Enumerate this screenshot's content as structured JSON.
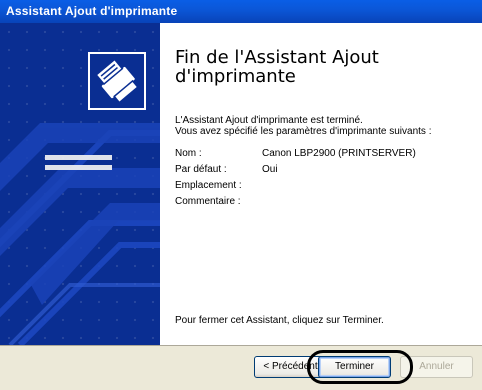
{
  "window": {
    "title": "Assistant Ajout d'imprimante"
  },
  "page": {
    "heading": "Fin de l'Assistant Ajout d'imprimante",
    "intro_line1": "L'Assistant Ajout d'imprimante est terminé.",
    "intro_line2": "Vous avez spécifié les paramètres d'imprimante suivants :",
    "fields": [
      {
        "label": "Nom :",
        "value": "Canon LBP2900 (PRINTSERVER)"
      },
      {
        "label": "Par défaut :",
        "value": "Oui"
      },
      {
        "label": "Emplacement :",
        "value": ""
      },
      {
        "label": "Commentaire :",
        "value": ""
      }
    ],
    "closing": "Pour fermer cet Assistant, cliquez sur Terminer."
  },
  "buttons": {
    "back_label": "< Précédent",
    "finish_label": "Terminer",
    "cancel_label": "Annuler"
  },
  "colors": {
    "title_bar": "#0b57d8",
    "side_panel": "#0a2e92",
    "dialog_background": "#ece9d8"
  },
  "icons": {
    "wizard_logo": "printer-wizard-icon"
  }
}
